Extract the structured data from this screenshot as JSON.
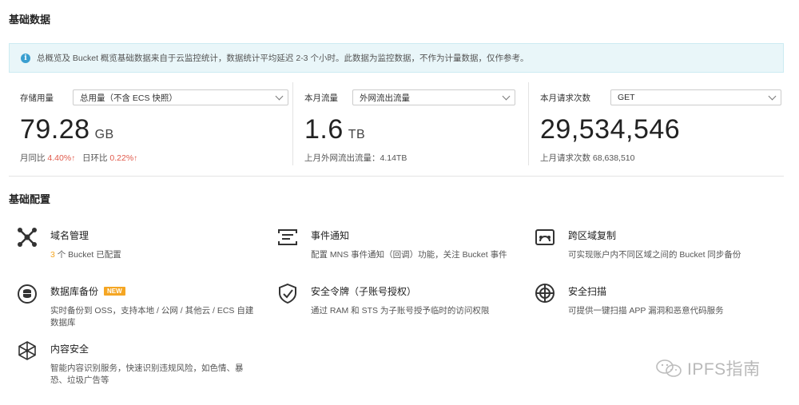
{
  "sections": {
    "basic_data_title": "基础数据",
    "basic_config_title": "基础配置"
  },
  "notice": {
    "text": "总概览及 Bucket 概览基础数据来自于云监控统计，数据统计平均延迟 2-3 个小时。此数据为监控数据，不作为计量数据，仅作参考。"
  },
  "stats": {
    "storage": {
      "label": "存储用量",
      "select": "总用量（不含 ECS 快照）",
      "value": "79.28",
      "unit": "GB",
      "mom_label": "月同比",
      "mom_value": "4.40%",
      "dod_label": "日环比",
      "dod_value": "0.22%"
    },
    "traffic": {
      "label": "本月流量",
      "select": "外网流出流量",
      "value": "1.6",
      "unit": "TB",
      "sub": "上月外网流出流量：4.14TB"
    },
    "requests": {
      "label": "本月请求次数",
      "select": "GET",
      "value": "29,534,546",
      "sub": "上月请求次数 68,638,510"
    }
  },
  "features": [
    {
      "title": "域名管理",
      "desc_num": "3",
      "desc": " 个 Bucket 已配置",
      "icon": "domain-icon"
    },
    {
      "title": "事件通知",
      "desc": "配置 MNS 事件通知（回调）功能，关注 Bucket 事件",
      "icon": "event-icon"
    },
    {
      "title": "跨区域复制",
      "desc": "可实现账户内不同区域之间的 Bucket 同步备份",
      "icon": "cross-region-icon"
    },
    {
      "title": "数据库备份",
      "badge": "NEW",
      "desc": "实时备份到 OSS，支持本地 / 公网 / 其他云 / ECS 自建数据库",
      "icon": "database-backup-icon"
    },
    {
      "title": "安全令牌（子账号授权）",
      "desc": "通过 RAM 和 STS 为子账号授予临时的访问权限",
      "icon": "token-icon"
    },
    {
      "title": "安全扫描",
      "desc": "可提供一键扫描 APP 漏洞和恶意代码服务",
      "icon": "scan-icon"
    },
    {
      "title": "内容安全",
      "desc": "智能内容识别服务，快速识别违规风险，如色情、暴恐、垃圾广告等",
      "icon": "content-security-icon"
    }
  ],
  "watermark": "IPFS指南",
  "colors": {
    "accent_red": "#e05a4b",
    "badge_orange": "#f5a623",
    "notice_bg": "#e9f6f9"
  }
}
